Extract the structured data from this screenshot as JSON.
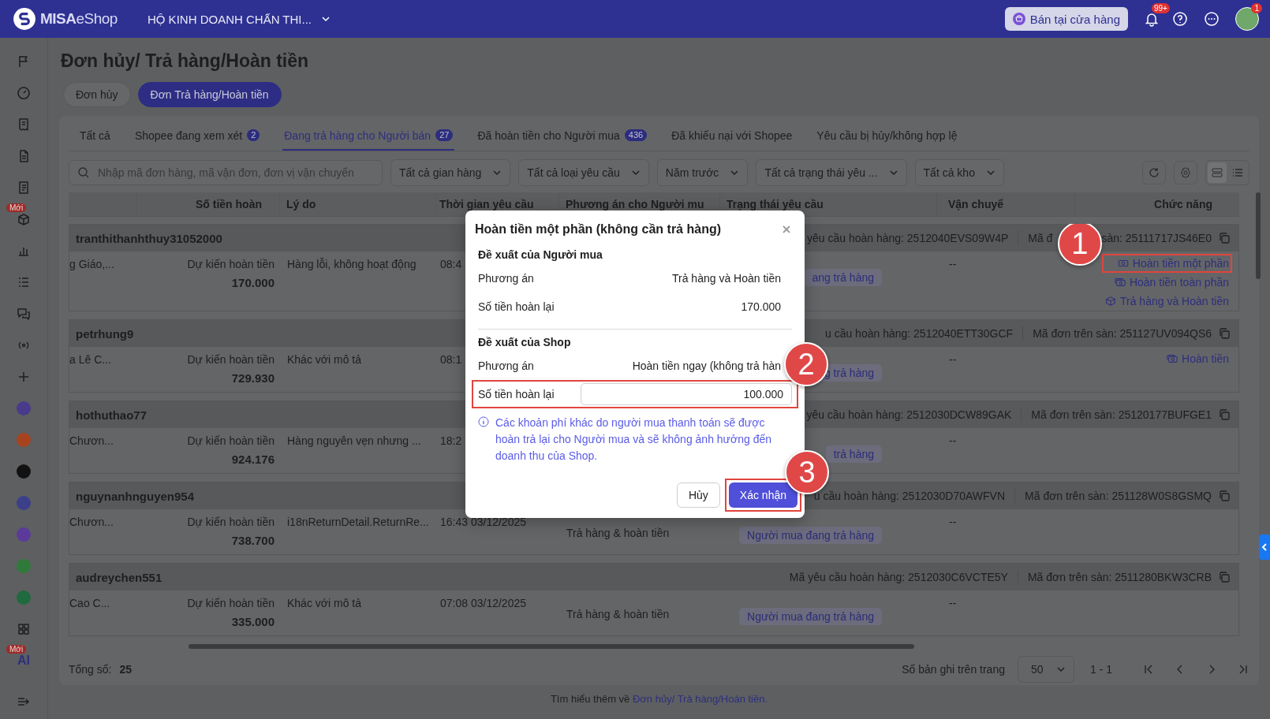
{
  "top_bar": {
    "brand": "**MISA**eShop",
    "store_name": "HỘ KINH DOANH CHẤN THI...",
    "sell_button": "Bán tại cửa hàng",
    "notification_badge": "99+",
    "avatar_badge": "1"
  },
  "sidebar": {
    "items": [
      {
        "kind": "nav"
      },
      {
        "kind": "nav"
      },
      {
        "kind": "nav"
      },
      {
        "kind": "nav"
      },
      {
        "kind": "nav"
      },
      {
        "kind": "nav",
        "badge": "Mới"
      },
      {
        "kind": "nav"
      },
      {
        "kind": "nav"
      },
      {
        "kind": "nav"
      },
      {
        "kind": "nav"
      },
      {
        "kind": "nav"
      },
      {
        "kind": "app",
        "color": "#4a3a8c"
      },
      {
        "kind": "app",
        "color": "#a8431f"
      },
      {
        "kind": "app",
        "color": "#121212"
      },
      {
        "kind": "app",
        "color": "#3c3f8a"
      },
      {
        "kind": "app",
        "color": "#5b3a9a"
      },
      {
        "kind": "app",
        "color": "#2f7a3a"
      },
      {
        "kind": "app",
        "color": "#1f6a3e"
      },
      {
        "kind": "nav"
      },
      {
        "kind": "text",
        "label": "AI",
        "badge": "Mới"
      }
    ]
  },
  "page_title": "Đơn hủy/ Trả hàng/Hoàn tiền",
  "segments": [
    {
      "label": "Đơn hủy",
      "selected": false
    },
    {
      "label": "Đơn Trả hàng/Hoàn tiền",
      "selected": true
    }
  ],
  "tabs": [
    {
      "label": "Tất cả",
      "selected": false
    },
    {
      "label": "Shopee đang xem xét",
      "count": "2",
      "selected": false
    },
    {
      "label": "Đang trả hàng cho Người bán",
      "count": "27",
      "selected": true
    },
    {
      "label": "Đã hoàn tiền cho Người mua",
      "count": "436",
      "selected": false
    },
    {
      "label": "Đã khiếu nại với Shopee",
      "selected": false
    },
    {
      "label": "Yêu cầu bị hủy/không hợp lệ",
      "selected": false
    }
  ],
  "filters": {
    "search": {
      "placeholder": "Nhập mã đơn hàng, mã vận đơn, đơn vị vận chuyển"
    },
    "dropdowns": [
      "Tất cả gian hàng",
      "Tất cả loại yêu cầu",
      "Năm trước",
      "Tất cả trạng thái yêu ...",
      "Tất cả kho"
    ],
    "view_modes": [
      {
        "kind": "card",
        "selected": true
      },
      {
        "kind": "list",
        "selected": false
      }
    ]
  },
  "table": {
    "columns": [
      "Số tiền hoàn",
      "Lý do",
      "Thời gian yêu cầu",
      "Phương án cho Người mu",
      "Trạng thái yêu cầu",
      "Vận chuyể",
      "Chức năng"
    ],
    "rows": [
      {
        "username": "tranthithanhthuy31052000",
        "request_code": "yêu cầu hoàn hàng: 2512040EVS09W4P",
        "order_code": "Mã đ",
        "order_code_tail": "sàn: 25111717JS46E0",
        "customer": "g Giáo,...",
        "amount_label": "Dự kiến hoàn tiền",
        "amount": "170.000",
        "reason": "Hàng lỗi, không hoạt động",
        "time": "08:4",
        "status": "ang trả hàng",
        "shipping": "--",
        "actions": [
          {
            "kind": "partial",
            "label": "Hoàn tiền một phần",
            "highlighted": true,
            "marker": "1"
          },
          {
            "kind": "full",
            "label": "Hoàn tiền toàn phần",
            "highlighted": false
          },
          {
            "kind": "return",
            "label": "Trả hàng và Hoàn tiền",
            "highlighted": false
          }
        ]
      },
      {
        "username": "petrhung9",
        "request_code": "u cầu hoàn hàng: 2512040ETT30GCF",
        "order_code": "Mã đơn trên sàn: 251127UV094QS6",
        "customer": "a Lê C...",
        "amount_label": "Dự kiến hoàn tiền",
        "amount": "729.930",
        "reason": "Khác với mô tả",
        "time": "08:1",
        "status": "g trả hàng",
        "shipping": "--",
        "actions": [
          {
            "kind": "full",
            "label": "Hoàn tiền",
            "highlighted": false
          }
        ]
      },
      {
        "username": "hothuthao77",
        "request_code": "yêu cầu hoàn hàng: 2512030DCW89GAK",
        "order_code": "Mã đơn trên sàn: 25120177BUFGE1",
        "customer": "Chươn...",
        "amount_label": "Dự kiến hoàn tiền",
        "amount": "924.176",
        "reason": "Hàng nguyên vẹn nhưng ...",
        "time": "18:2",
        "status": "trả hàng",
        "shipping": "--",
        "actions": []
      },
      {
        "username": "nguynanhnguyen954",
        "request_code": "u cầu hoàn hàng: 2512030D70AWFVN",
        "order_code": "Mã đơn trên sàn: 251128W0S8GSMQ",
        "customer": "Chươn...",
        "amount_label": "Dự kiến hoàn tiền",
        "amount": "738.700",
        "reason": "i18nReturnDetail.ReturnRe...",
        "time": "16:43 03/12/2025",
        "option": "Trả hàng & hoàn tiền",
        "status": "Người mua đang trả hàng",
        "shipping": "--",
        "actions": []
      },
      {
        "username": "audreychen551",
        "request_code": "Mã yêu cầu hoàn hàng: 2512030C6VCTE5Y",
        "order_code": "Mã đơn trên sàn: 2511280BKW3CRB",
        "customer": "Cao C...",
        "amount_label": "Dự kiến hoàn tiền",
        "amount": "335.000",
        "reason": "Khác với mô tả",
        "time": "07:08 03/12/2025",
        "option": "Trả hàng & hoàn tiền",
        "status": "Người mua đang trả hàng",
        "shipping": "--",
        "actions": []
      }
    ]
  },
  "footer": {
    "total_label": "Tổng số:",
    "total": "25",
    "page_size_label": "Số bản ghi trên trang",
    "page_size": "50",
    "range": "1 - 1"
  },
  "learn_more": {
    "text": "Tìm hiểu thêm về",
    "link": "Đơn hủy/ Trả hàng/Hoàn tiền."
  },
  "modal": {
    "title": "Hoàn tiền một phần (không cần trả hàng)",
    "sections": [
      {
        "heading": "Đề xuất của Người mua",
        "rows": [
          {
            "kind": "text",
            "label": "Phương án",
            "value": "Trả hàng và Hoàn tiền",
            "highlighted": false
          },
          {
            "kind": "text",
            "label": "Số tiền hoàn lại",
            "value": "170.000",
            "highlighted": false
          }
        ]
      },
      {
        "heading": "Đề xuất của Shop",
        "rows": [
          {
            "kind": "text",
            "label": "Phương án",
            "value": "Hoàn tiền ngay (không trả hàn",
            "highlighted": false
          },
          {
            "kind": "input",
            "label": "Số tiền hoàn lại",
            "value": "100.000",
            "highlighted": true,
            "marker": "2"
          }
        ]
      }
    ],
    "note": "Các khoản phí khác do người mua thanh toán sẽ được hoàn trả lại cho Người mua và sẽ không ảnh hưởng đến doanh thu của Shop.",
    "cancel": "Hủy",
    "confirm": {
      "label": "Xác nhận",
      "highlighted": true,
      "marker": "3"
    }
  }
}
